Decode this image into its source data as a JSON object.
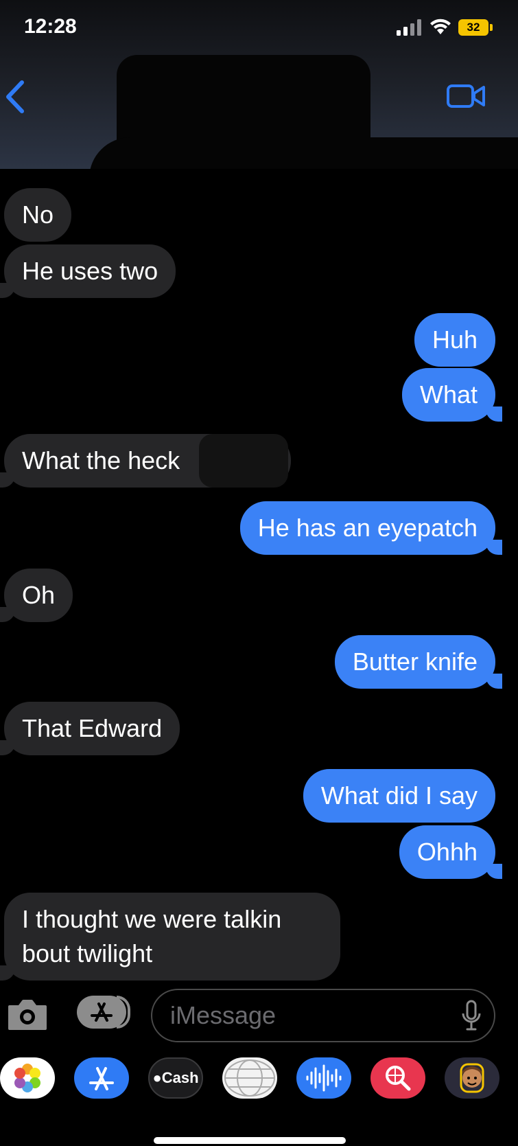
{
  "status_bar": {
    "time": "12:28",
    "battery": "32"
  },
  "messages": [
    {
      "id": "m1",
      "side": "in",
      "text": "No"
    },
    {
      "id": "m2",
      "side": "in",
      "text": "He uses two"
    },
    {
      "id": "m3",
      "side": "out",
      "text": "Huh"
    },
    {
      "id": "m4",
      "side": "out",
      "text": "What"
    },
    {
      "id": "m5",
      "side": "in",
      "text": "What the heck"
    },
    {
      "id": "m6",
      "side": "out",
      "text": "He has an eyepatch"
    },
    {
      "id": "m7",
      "side": "in",
      "text": "Oh"
    },
    {
      "id": "m8",
      "side": "out",
      "text": "Butter knife"
    },
    {
      "id": "m9",
      "side": "in",
      "text": "That Edward"
    },
    {
      "id": "m10",
      "side": "out",
      "text": "What did I say"
    },
    {
      "id": "m11",
      "side": "out",
      "text": "Ohhh"
    },
    {
      "id": "m12a",
      "side": "in",
      "text": "I thought we were talkin"
    },
    {
      "id": "m12b",
      "side": "in",
      "text": "bout twilight"
    }
  ],
  "composer": {
    "placeholder": "iMessage"
  },
  "app_tray": {
    "cash_label": "Cash",
    "apps": [
      "photos-icon",
      "app-store-icon",
      "apple-cash-icon",
      "sticker-globe-icon",
      "audio-message-icon",
      "image-search-icon",
      "memoji-icon"
    ]
  },
  "colors": {
    "incoming": "#262628",
    "outgoing": "#3b82f6",
    "accent": "#2f7bf5"
  }
}
